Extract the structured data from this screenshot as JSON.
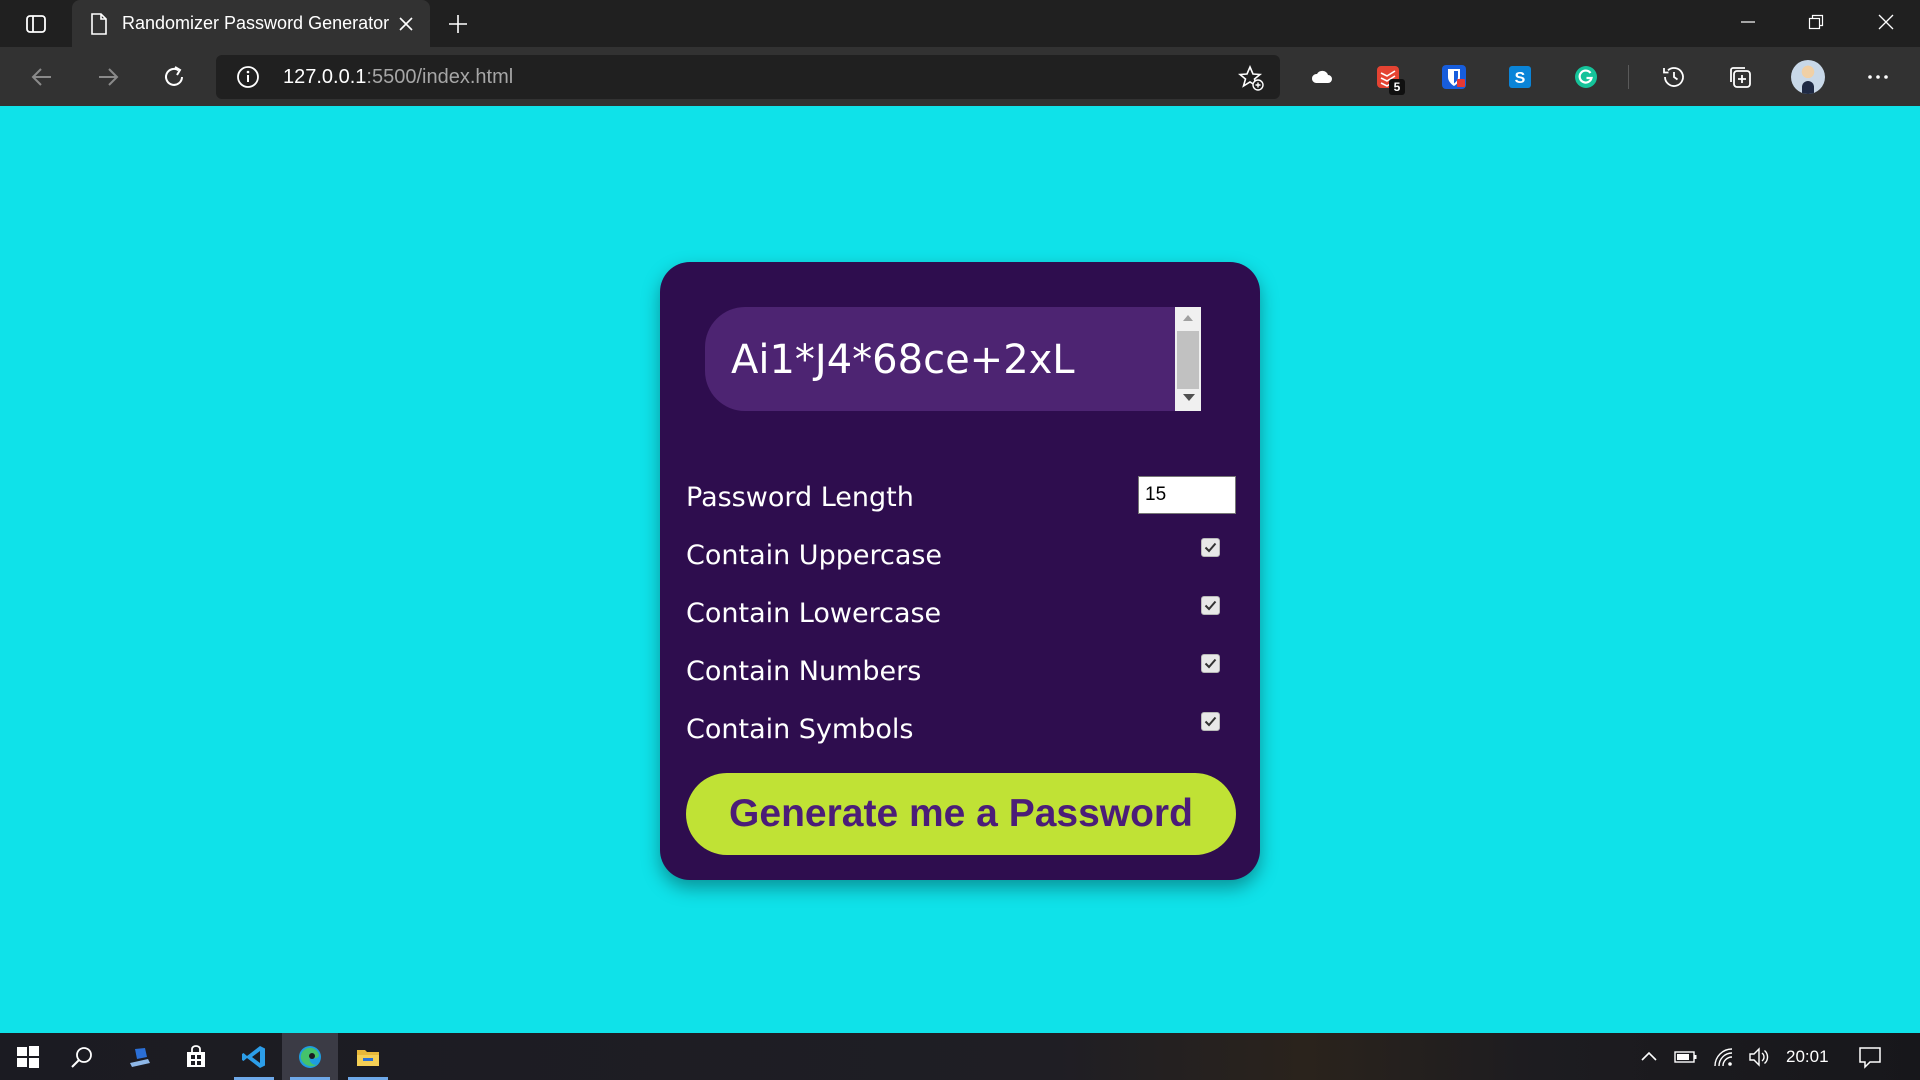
{
  "browser": {
    "tab_title": "Randomizer Password Generator",
    "url_host": "127.0.0.1",
    "url_rest": ":5500/index.html",
    "extensions": [
      {
        "name": "cloud-extension-icon",
        "color": "#ffffff"
      },
      {
        "name": "todoist-extension-icon",
        "color": "#e44332",
        "badge": "5"
      },
      {
        "name": "bitwarden-extension-icon",
        "color": "#175ddc"
      },
      {
        "name": "skype-extension-icon",
        "color": "#0a84d8"
      },
      {
        "name": "grammarly-extension-icon",
        "color": "#15c39a"
      }
    ]
  },
  "app": {
    "password": "Ai1*J4*68ce+2xL",
    "length_label": "Password Length",
    "length_value": "15",
    "options": [
      {
        "label": "Contain Uppercase",
        "checked": true
      },
      {
        "label": "Contain Lowercase",
        "checked": true
      },
      {
        "label": "Contain Numbers",
        "checked": true
      },
      {
        "label": "Contain Symbols",
        "checked": true
      }
    ],
    "generate_label": "Generate me a Password"
  },
  "colors": {
    "page_bg": "#0fe2e9",
    "card_bg": "#2e0d4e",
    "output_bg": "#4d2472",
    "button_bg": "#c0e235",
    "button_text": "#4b1d78"
  },
  "taskbar": {
    "apps": [
      "start-icon",
      "search-icon",
      "pen-app-icon",
      "store-icon",
      "vscode-icon",
      "edge-icon",
      "file-explorer-icon"
    ],
    "time": "20:01"
  }
}
